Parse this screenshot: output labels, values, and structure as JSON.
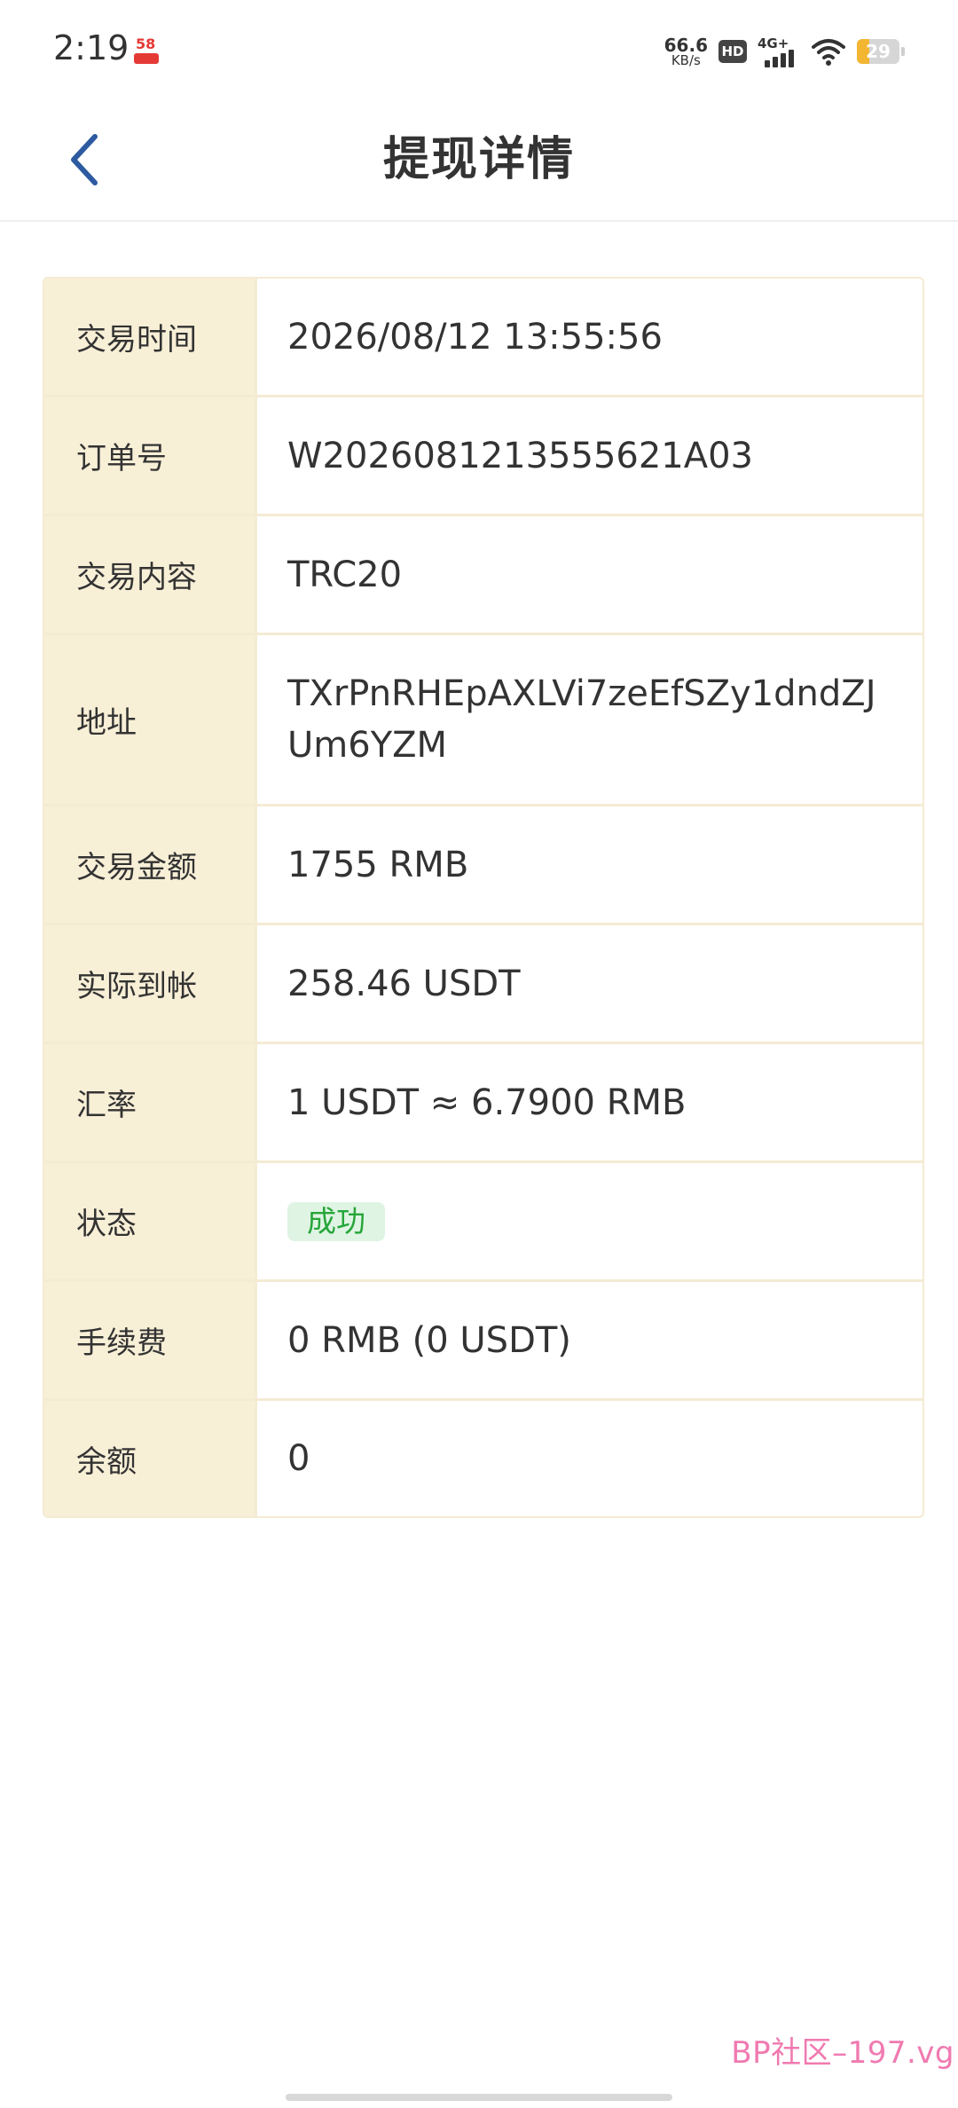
{
  "status_bar": {
    "time": "2:19",
    "app_badge_text": "58",
    "net_speed_value": "66.6",
    "net_speed_unit": "KB/s",
    "hd_label": "HD",
    "signal_label": "4G+",
    "battery_level": "29",
    "battery_color": "#f2b632"
  },
  "header": {
    "title": "提现详情",
    "back_icon": "chevron-left-icon",
    "accent_color": "#2d5aa0"
  },
  "details": [
    {
      "label": "交易时间",
      "value": "2026/08/12 13:55:56"
    },
    {
      "label": "订单号",
      "value": "W2026081213555621A03"
    },
    {
      "label": "交易内容",
      "value": "TRC20"
    },
    {
      "label": "地址",
      "value": "TXrPnRHEpAXLVi7zeEfSZy1dndZJUm6YZM"
    },
    {
      "label": "交易金额",
      "value": "1755 RMB"
    },
    {
      "label": "实际到帐",
      "value": "258.46 USDT"
    },
    {
      "label": "汇率",
      "value": "1 USDT ≈ 6.7900 RMB"
    },
    {
      "label": "状态",
      "value": "成功",
      "status_color": "#26a63a"
    },
    {
      "label": "手续费",
      "value": "0 RMB (0 USDT)"
    },
    {
      "label": "余额",
      "value": "0"
    }
  ],
  "watermark": "BP社区–197.vg"
}
